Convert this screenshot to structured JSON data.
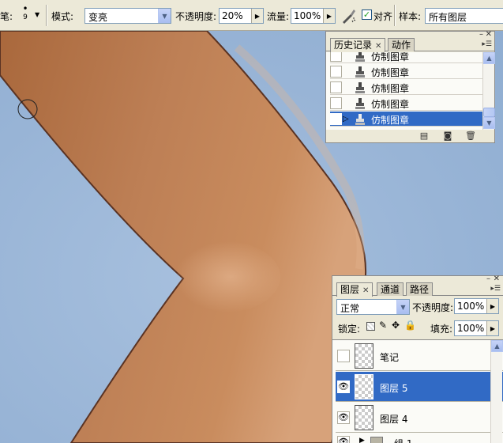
{
  "options_bar": {
    "brush_label": "笔:",
    "brush_size": "9",
    "mode_label": "模式:",
    "mode_value": "变亮",
    "opacity_label": "不透明度:",
    "opacity_value": "20%",
    "flow_label": "流量:",
    "flow_value": "100%",
    "airbrush_icon": "airbrush-icon",
    "aligned_label": "对齐",
    "aligned_checked": true,
    "sample_label": "样本:",
    "sample_value": "所有图层"
  },
  "history_panel": {
    "tabs": [
      {
        "label": "历史记录",
        "active": true,
        "closable": true
      },
      {
        "label": "动作",
        "active": false,
        "closable": false
      }
    ],
    "items": [
      {
        "label": "仿制图章",
        "selected": false
      },
      {
        "label": "仿制图章",
        "selected": false
      },
      {
        "label": "仿制图章",
        "selected": false
      },
      {
        "label": "仿制图章",
        "selected": false
      },
      {
        "label": "仿制图章",
        "selected": true
      }
    ],
    "footer_icons": [
      "new-document-icon",
      "snapshot-icon",
      "trash-icon"
    ]
  },
  "layers_panel": {
    "tabs": [
      {
        "label": "图层",
        "active": true,
        "closable": true
      },
      {
        "label": "通道",
        "active": false
      },
      {
        "label": "路径",
        "active": false
      }
    ],
    "blend_mode": "正常",
    "opacity_label": "不透明度:",
    "opacity_value": "100%",
    "lock_label": "锁定:",
    "fill_label": "填充:",
    "fill_value": "100%",
    "layers": [
      {
        "name": "笔记",
        "visible": false,
        "selected": false,
        "type": "layer"
      },
      {
        "name": "图层 5",
        "visible": true,
        "selected": true,
        "type": "layer"
      },
      {
        "name": "图层 4",
        "visible": true,
        "selected": false,
        "type": "layer"
      },
      {
        "name": "组 1",
        "visible": true,
        "selected": false,
        "type": "group"
      }
    ]
  },
  "colors": {
    "selection": "#316ac5",
    "panel_bg": "#ece9d8",
    "canvas_bg": "#9ab7d9",
    "skin": "#b87a4f"
  }
}
